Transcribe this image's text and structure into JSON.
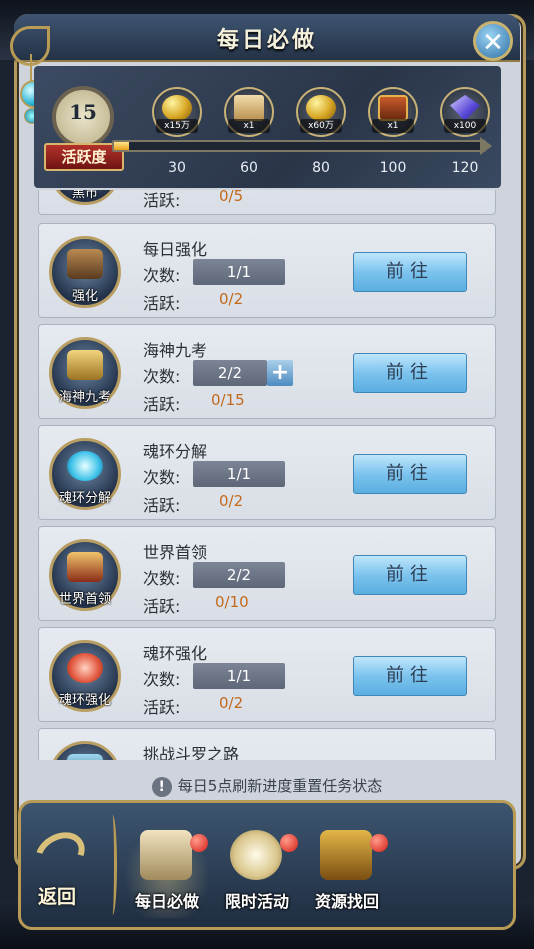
{
  "window": {
    "title": "每日必做",
    "close_symbol": "✕"
  },
  "activity": {
    "value": "15",
    "label": "活跃度",
    "progress_fraction": 0.04,
    "rewards": [
      {
        "icon": "gold-coins-icon",
        "qty": "x15万",
        "milestone": "30"
      },
      {
        "icon": "scroll-icon",
        "qty": "x1",
        "milestone": "60"
      },
      {
        "icon": "gold-coins-icon",
        "qty": "x60万",
        "milestone": "80"
      },
      {
        "icon": "treasure-chest-icon",
        "qty": "x1",
        "milestone": "100"
      },
      {
        "icon": "diamond-icon",
        "qty": "x100",
        "milestone": "120"
      }
    ]
  },
  "labels": {
    "count": "次数:",
    "active": "活跃:",
    "go": "前往"
  },
  "tasks": [
    {
      "icon_label": "黑市",
      "name": "",
      "count": "",
      "active": "0/5"
    },
    {
      "icon_label": "强化",
      "name": "每日强化",
      "count": "1/1",
      "active": "0/2"
    },
    {
      "icon_label": "海神九考",
      "name": "海神九考",
      "count": "2/2",
      "active": "0/15",
      "has_plus": true
    },
    {
      "icon_label": "魂环分解",
      "name": "魂环分解",
      "count": "1/1",
      "active": "0/2"
    },
    {
      "icon_label": "世界首领",
      "name": "世界首领",
      "count": "2/2",
      "active": "0/10"
    },
    {
      "icon_label": "魂环强化",
      "name": "魂环强化",
      "count": "1/1",
      "active": "0/2"
    },
    {
      "icon_label": "",
      "name": "挑战斗罗之路",
      "count": "",
      "active": ""
    }
  ],
  "notice": {
    "icon": "!",
    "text": "每日5点刷新进度重置任务状态"
  },
  "nav": {
    "back_label": "返回",
    "tabs": [
      {
        "label": "每日必做",
        "active": true,
        "badge": true
      },
      {
        "label": "限时活动",
        "active": false,
        "badge": true
      },
      {
        "label": "资源找回",
        "active": false,
        "badge": true
      }
    ]
  },
  "colors": {
    "accent_gold": "#b89c55",
    "progress": "#e7a21b",
    "go_button": "#7cc3ee",
    "badge_red": "#d41d14"
  }
}
